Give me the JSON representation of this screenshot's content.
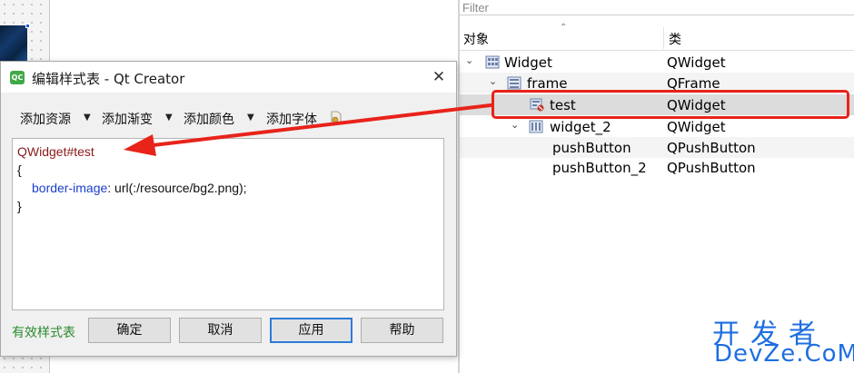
{
  "inspector": {
    "filter_placeholder": "Filter",
    "col_object": "对象",
    "col_class": "类",
    "rows": [
      {
        "name": "Widget",
        "cls": "QWidget"
      },
      {
        "name": "frame",
        "cls": "QFrame"
      },
      {
        "name": "test",
        "cls": "QWidget"
      },
      {
        "name": "widget_2",
        "cls": "QWidget"
      },
      {
        "name": "pushButton",
        "cls": "QPushButton"
      },
      {
        "name": "pushButton_2",
        "cls": "QPushButton"
      }
    ]
  },
  "dialog": {
    "app_icon_text": "QC",
    "title": "编辑样式表 - Qt Creator",
    "close": "✕",
    "toolbar": {
      "add_resource": "添加资源",
      "add_gradient": "添加渐变",
      "add_color": "添加颜色",
      "add_font": "添加字体"
    },
    "editor": {
      "selector": "QWidget#test",
      "open_brace": "{",
      "property": "border-image",
      "value": ": url(:/resource/bg2.png);",
      "close_brace": "}"
    },
    "status": "有效样式表",
    "buttons": {
      "ok": "确定",
      "cancel": "取消",
      "apply": "应用",
      "help": "帮助"
    }
  },
  "watermark": {
    "line1": "开发者",
    "line2": "DevZe.CoM"
  },
  "colors": {
    "highlight": "#e8231a",
    "selector": "#8b1a1a",
    "property": "#1c3fd0",
    "status_valid": "#2b8a2b",
    "watermark": "#1d6fe0"
  }
}
